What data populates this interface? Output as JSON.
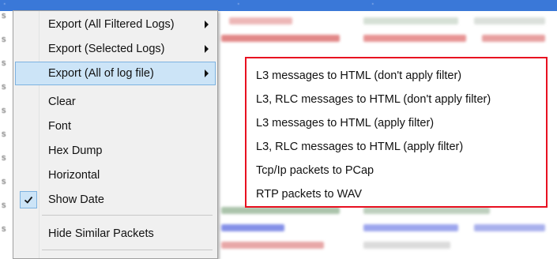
{
  "menu": {
    "items": [
      {
        "label": "Export (All Filtered Logs)",
        "submenu": true
      },
      {
        "label": "Export (Selected Logs)",
        "submenu": true
      },
      {
        "label": "Export (All of log file)",
        "submenu": true,
        "highlighted": true
      },
      {
        "label": "Clear"
      },
      {
        "label": "Font"
      },
      {
        "label": "Hex Dump"
      },
      {
        "label": "Horizontal"
      },
      {
        "label": "Show Date",
        "checked": true
      },
      {
        "label": "Hide Similar Packets"
      }
    ]
  },
  "submenu": {
    "items": [
      {
        "label": "L3 messages to HTML (don't apply filter)"
      },
      {
        "label": "L3, RLC messages to HTML (don't apply filter)"
      },
      {
        "label": "L3 messages to HTML (apply filter)"
      },
      {
        "label": "L3, RLC messages to HTML (apply filter)"
      },
      {
        "label": "Tcp/Ip packets to PCap"
      },
      {
        "label": "RTP packets to WAV"
      }
    ],
    "highlight_border_color": "#e81020"
  },
  "colors": {
    "menu_background": "#f0f0f0",
    "menu_highlight": "#cce4f7",
    "selected_row": "#3a78d8"
  }
}
